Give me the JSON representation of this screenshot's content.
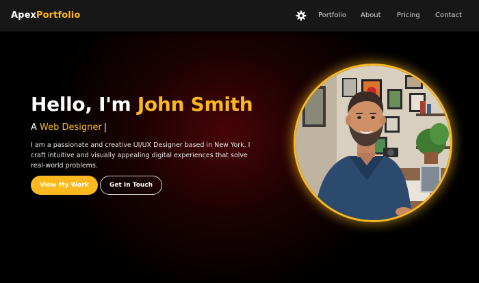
{
  "header": {
    "logo_part1": "Apex",
    "logo_part2": "Portfolio",
    "theme_icon": "gear-sun-icon",
    "nav": [
      "Portfolio",
      "About",
      "Pricing",
      "Contact"
    ]
  },
  "hero": {
    "greeting": "Hello, I'm",
    "name": "John Smith",
    "role_prefix": "A",
    "role": "Web Designer",
    "caret": "|",
    "bio": "I am a passionate and creative UI/UX Designer based in New York. I craft intuitive and visually appealing digital experiences that solve real-world problems.",
    "cta_primary": "View My Work",
    "cta_secondary": "Get In Touch"
  },
  "colors": {
    "accent": "#fbb81f",
    "nav_bg": "#171717",
    "page_bg": "#000000",
    "glow": "#5c0608"
  }
}
